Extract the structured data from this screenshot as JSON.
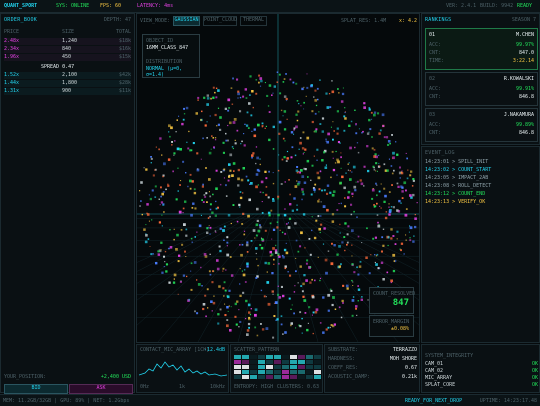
{
  "topbar": {
    "brand": "QUANT_SPORT",
    "sys": "SYS: ONLINE",
    "fps": "FPS: 60",
    "latency": "LATENCY: 4ms",
    "version": "VER: 2.4.1",
    "build": "BUILD: 9942",
    "ready": "READY"
  },
  "order_book": {
    "title": "ORDER_BOOK",
    "depth": "DEPTH: 47",
    "headers": [
      "PRICE",
      "SIZE",
      "TOTAL"
    ],
    "asks": [
      {
        "price": "2.48x",
        "size": "1,240",
        "total": "$18k"
      },
      {
        "price": "2.34x",
        "size": "840",
        "total": "$16k"
      },
      {
        "price": "1.96x",
        "size": "450",
        "total": "$15k"
      }
    ],
    "spread": "SPREAD 0.47",
    "bids": [
      {
        "price": "1.52x",
        "size": "2,100",
        "total": "$42k"
      },
      {
        "price": "1.44x",
        "size": "1,800",
        "total": "$28k"
      },
      {
        "price": "1.31x",
        "size": "900",
        "total": "$11k"
      }
    ],
    "position_label": "YOUR_POSITION:",
    "position_value": "+2,400 USD",
    "bid_label": "BID",
    "ask_label": "ASK"
  },
  "viewport": {
    "view_mode_label": "VIEW_MODE:",
    "modes": [
      "GAUSSIAN",
      "POINT_CLOUD",
      "THERMAL"
    ],
    "splat_res": "SPLAT_RES: 1.4M",
    "zoom": "x: 4.2",
    "object_id_label": "OBJECT_ID",
    "object_id_value": "16MM_CLASS_847",
    "distribution_label": "DISTRIBUTION",
    "distribution_value": "NORMAL (μ=0, σ=1.4)",
    "count_label": "COUNT_RESOLVED",
    "count_value": "847",
    "error_label": "ERROR_MARGIN",
    "error_value": "±0.08%"
  },
  "rankings": {
    "title": "RANKINGS",
    "season": "SEASON 7",
    "entries": [
      {
        "rank": "01",
        "name": "M.CHEN",
        "acc_label": "ACC:",
        "acc": "99.97%",
        "cnt_label": "CNT:",
        "cnt": "847.0",
        "time_label": "TIME:",
        "time": "3:22.14"
      },
      {
        "rank": "02",
        "name": "R.KOWALSKI",
        "acc_label": "ACC:",
        "acc": "99.91%",
        "cnt_label": "CNT:",
        "cnt": "846.8"
      },
      {
        "rank": "03",
        "name": "J.NAKAMURA",
        "acc_label": "ACC:",
        "acc": "99.89%",
        "cnt_label": "CNT:",
        "cnt": "846.8"
      }
    ]
  },
  "event_log": {
    "title": "EVENT_LOG",
    "entries": [
      {
        "time": "14:23:01",
        "text": "> SPILL_INIT",
        "color": "#8fa3ab"
      },
      {
        "time": "14:23:02",
        "text": "> COUNT_START",
        "color": "#22d3ee"
      },
      {
        "time": "14:23:05",
        "text": "> IMPACT_2AB",
        "color": "#8fa3ab"
      },
      {
        "time": "14:23:08",
        "text": "> ROLL_DETECT",
        "color": "#8fa3ab"
      },
      {
        "time": "14:23:12",
        "text": "> COUNT_END",
        "color": "#22e05a"
      },
      {
        "time": "14:23:13",
        "text": "> VERIFY_OK",
        "color": "#f5c542"
      }
    ]
  },
  "contact": {
    "title": "CONTACT_MIC_ARRAY [1CH]",
    "value": "-12.4dB",
    "labels": [
      "0Hz",
      "1k",
      "10kHz"
    ]
  },
  "scatter": {
    "title": "SCATTER_PATTERN",
    "footer_left": "ENTROPY: HIGH",
    "footer_right": "CLUSTERS: 0.63"
  },
  "substrate": {
    "rows": [
      {
        "label": "SUBSTRATE:",
        "value": "TERRAZZO"
      },
      {
        "label": "HARDNESS:",
        "value": "MOH SHORE"
      },
      {
        "label": "COEFF_RES:",
        "value": "0.67"
      },
      {
        "label": "ACOUSTIC_DAMP:",
        "value": "0.21k"
      }
    ]
  },
  "integrity": {
    "title": "SYSTEM_INTEGRITY",
    "rows": [
      {
        "label": "CAM_01",
        "value": "OK"
      },
      {
        "label": "CAM_02",
        "value": "OK"
      },
      {
        "label": "MIC_ARRAY",
        "value": "OK"
      },
      {
        "label": "SPLAT_CORE",
        "value": "OK"
      }
    ]
  },
  "statusbar": {
    "left": "MEM: 11.2GB/32GB  |  GPU: 89%  |  NET: 1.2Gbps",
    "ready": "READY_FOR_NEXT_DROP",
    "uptime": "UPTIME: 14:23:17.48"
  },
  "colors": {
    "cyan": "#22d3ee",
    "green": "#22e05a",
    "magenta": "#e040e0",
    "yellow": "#f5c542"
  }
}
